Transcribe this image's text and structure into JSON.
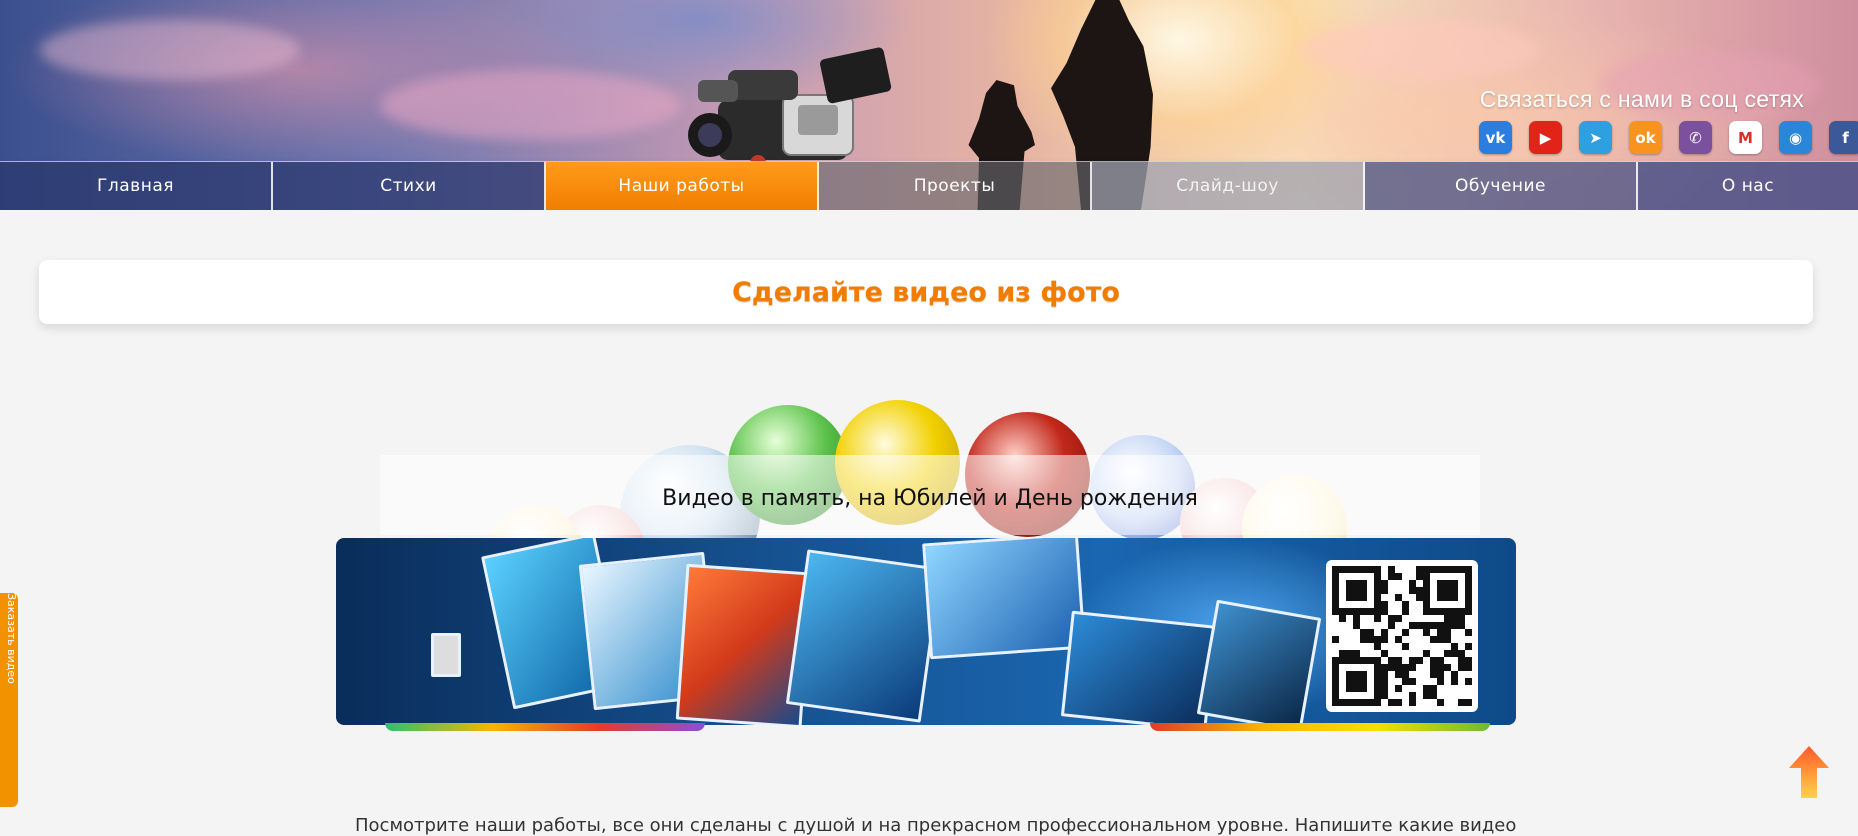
{
  "header": {
    "social_title": "Связаться с нами в соц сетях",
    "social_links": [
      {
        "name": "vk-icon",
        "glyph": "vk",
        "color": "#2b7de0"
      },
      {
        "name": "youtube-icon",
        "glyph": "▶",
        "color": "#e2231a"
      },
      {
        "name": "telegram-icon",
        "glyph": "➤",
        "color": "#2ea0e0"
      },
      {
        "name": "odnoklassniki-icon",
        "glyph": "ok",
        "color": "#f7931e"
      },
      {
        "name": "viber-icon",
        "glyph": "✆",
        "color": "#7b519d"
      },
      {
        "name": "gmail-icon",
        "glyph": "M",
        "color": "#ffffff"
      },
      {
        "name": "android-icon",
        "glyph": "◉",
        "color": "#2a86d8"
      },
      {
        "name": "facebook-icon",
        "glyph": "f",
        "color": "#3b5998"
      }
    ]
  },
  "nav": {
    "items": [
      {
        "label": "Главная",
        "active": false
      },
      {
        "label": "Стихи",
        "active": false
      },
      {
        "label": "Наши работы",
        "active": true
      },
      {
        "label": "Проекты",
        "active": false
      },
      {
        "label": "Слайд-шоу",
        "active": false
      },
      {
        "label": "Обучение",
        "active": false
      },
      {
        "label": "О нас",
        "active": false
      }
    ]
  },
  "main": {
    "page_title": "Сделайте видео из фото",
    "video_caption": "Видео в память, на Юбилей и День рождения",
    "intro_text": "Посмотрите наши работы, все они сделаны с душой и на прекрасном профессиональном уровне. Напишите какие видео"
  },
  "colors": {
    "accent": "#f07d00",
    "active_nav": "#ff9a1a"
  },
  "side_tab": {
    "label": "Заказать видео"
  }
}
